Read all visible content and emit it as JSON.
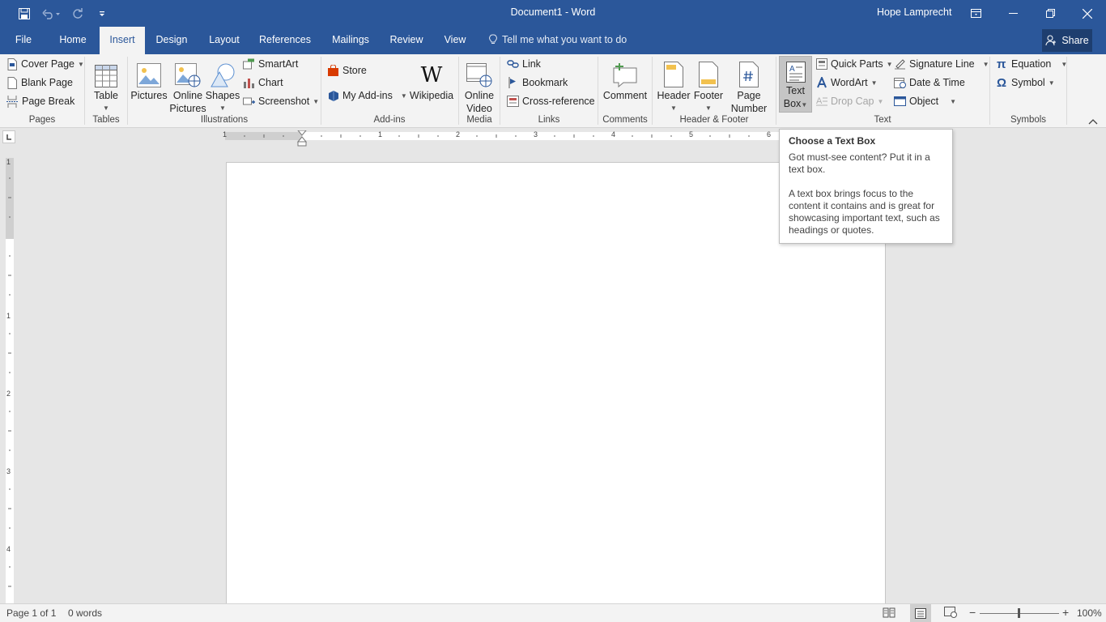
{
  "window": {
    "title": "Document1 - Word",
    "user_name": "Hope Lamprecht"
  },
  "tabs": [
    {
      "label": "File"
    },
    {
      "label": "Home"
    },
    {
      "label": "Insert"
    },
    {
      "label": "Design"
    },
    {
      "label": "Layout"
    },
    {
      "label": "References"
    },
    {
      "label": "Mailings"
    },
    {
      "label": "Review"
    },
    {
      "label": "View"
    }
  ],
  "tell_me": "Tell me what you want to do",
  "share_label": "Share",
  "ribbon": {
    "pages": {
      "label": "Pages",
      "cover_page": "Cover Page",
      "blank_page": "Blank Page",
      "page_break": "Page Break"
    },
    "tables": {
      "label": "Tables",
      "table": "Table"
    },
    "illustrations": {
      "label": "Illustrations",
      "pictures": "Pictures",
      "online_pictures_1": "Online",
      "online_pictures_2": "Pictures",
      "shapes": "Shapes",
      "smartart": "SmartArt",
      "chart": "Chart",
      "screenshot": "Screenshot"
    },
    "addins": {
      "label": "Add-ins",
      "store": "Store",
      "my_addins": "My Add-ins",
      "wikipedia": "Wikipedia",
      "wikipedia_glyph": "W"
    },
    "media": {
      "label": "Media",
      "online_video_1": "Online",
      "online_video_2": "Video"
    },
    "links": {
      "label": "Links",
      "link": "Link",
      "bookmark": "Bookmark",
      "cross_reference": "Cross-reference"
    },
    "comments": {
      "label": "Comments",
      "comment": "Comment"
    },
    "header_footer": {
      "label": "Header & Footer",
      "header": "Header",
      "footer": "Footer",
      "page_number_1": "Page",
      "page_number_2": "Number"
    },
    "text": {
      "label": "Text",
      "text_box_1": "Text",
      "text_box_2": "Box",
      "quick_parts": "Quick Parts",
      "wordart": "WordArt",
      "drop_cap": "Drop Cap",
      "signature_line": "Signature Line",
      "date_time": "Date & Time",
      "object": "Object"
    },
    "symbols": {
      "label": "Symbols",
      "equation": "Equation",
      "symbol": "Symbol",
      "equation_glyph": "π",
      "symbol_glyph": "Ω"
    }
  },
  "ruler": {
    "h_labels": [
      "1",
      "1",
      "2",
      "3",
      "4",
      "5",
      "6"
    ],
    "v_labels": [
      "1",
      "1",
      "2",
      "3",
      "4"
    ]
  },
  "tooltip": {
    "title": "Choose a Text Box",
    "para1": "Got must-see content? Put it in a text box.",
    "para2": "A text box brings focus to the content it contains and is great for showcasing important text, such as headings or quotes."
  },
  "status": {
    "page": "Page 1 of 1",
    "words": "0 words",
    "zoom": "100%"
  },
  "colors": {
    "accent": "#2b579a",
    "ribbon_bg": "#f3f3f3",
    "workspace_bg": "#e6e6e6"
  }
}
